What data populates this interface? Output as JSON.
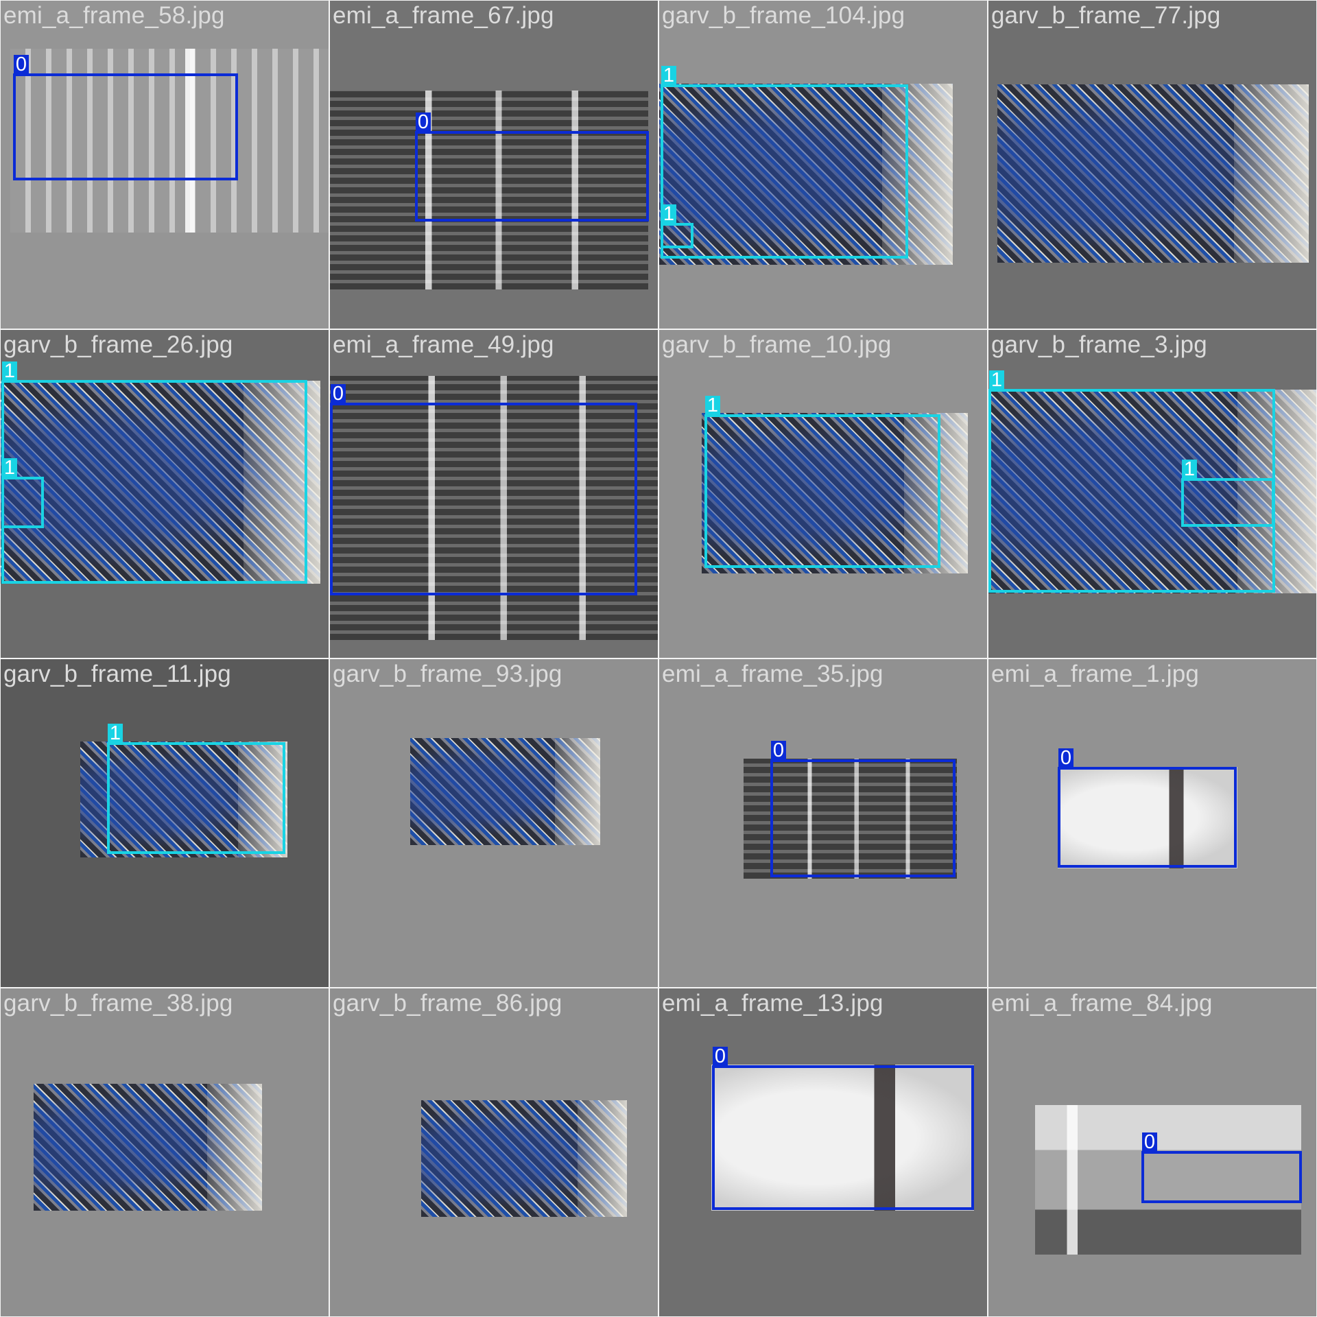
{
  "colors": {
    "class_0": "#0b2bd6",
    "class_1": "#19d3e4",
    "label_text": "#dcdcdc"
  },
  "tiles": [
    {
      "filename": "emi_a_frame_58.jpg",
      "labels": [
        "0"
      ]
    },
    {
      "filename": "emi_a_frame_67.jpg",
      "labels": [
        "0"
      ]
    },
    {
      "filename": "garv_b_frame_104.jpg",
      "labels": [
        "1",
        "1"
      ]
    },
    {
      "filename": "garv_b_frame_77.jpg",
      "labels": []
    },
    {
      "filename": "garv_b_frame_26.jpg",
      "labels": [
        "1",
        "1"
      ]
    },
    {
      "filename": "emi_a_frame_49.jpg",
      "labels": [
        "0"
      ]
    },
    {
      "filename": "garv_b_frame_10.jpg",
      "labels": [
        "1"
      ]
    },
    {
      "filename": "garv_b_frame_3.jpg",
      "labels": [
        "1",
        "1"
      ]
    },
    {
      "filename": "garv_b_frame_11.jpg",
      "labels": [
        "1"
      ]
    },
    {
      "filename": "garv_b_frame_93.jpg",
      "labels": []
    },
    {
      "filename": "emi_a_frame_35.jpg",
      "labels": [
        "0"
      ]
    },
    {
      "filename": "emi_a_frame_1.jpg",
      "labels": [
        "0"
      ]
    },
    {
      "filename": "garv_b_frame_38.jpg",
      "labels": []
    },
    {
      "filename": "garv_b_frame_86.jpg",
      "labels": []
    },
    {
      "filename": "emi_a_frame_13.jpg",
      "labels": [
        "0"
      ]
    },
    {
      "filename": "emi_a_frame_84.jpg",
      "labels": [
        "0"
      ]
    }
  ]
}
